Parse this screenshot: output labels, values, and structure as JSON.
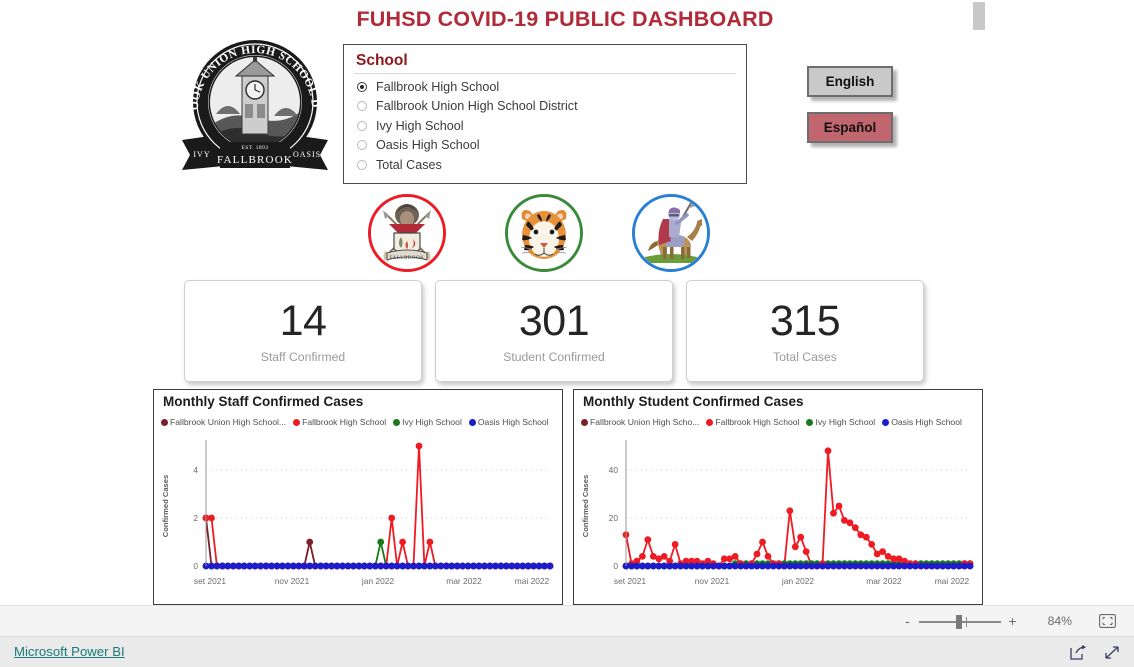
{
  "title": "FUHSD COVID-19 PUBLIC DASHBOARD",
  "seal": {
    "arc_text": "FALLBROOK UNION HIGH SCHOOL DISTRICT",
    "banner_left": "IVY",
    "banner_center": "FALLBROOK",
    "banner_right": "OASIS",
    "established": "EST. 1893"
  },
  "slicer": {
    "header": "School",
    "items": [
      {
        "label": "Fallbrook High School",
        "selected": true
      },
      {
        "label": "Fallbrook Union High School District",
        "selected": false
      },
      {
        "label": "Ivy High School",
        "selected": false
      },
      {
        "label": "Oasis High School",
        "selected": false
      },
      {
        "label": "Total Cases",
        "selected": false
      }
    ]
  },
  "language": {
    "english_label": "English",
    "espanol_label": "Español",
    "english_bg": "#c9c9c9",
    "espanol_bg": "#c1666e"
  },
  "logos": [
    {
      "name": "fallbrook-warriors-logo",
      "ring_color": "#ec1c24"
    },
    {
      "name": "ivy-tigers-logo",
      "ring_color": "#3a8a3a"
    },
    {
      "name": "oasis-knights-logo",
      "ring_color": "#2a7fd4"
    }
  ],
  "kpis": [
    {
      "value": "14",
      "label": "Staff Confirmed"
    },
    {
      "value": "301",
      "label": "Student Confirmed"
    },
    {
      "value": "315",
      "label": "Total Cases"
    }
  ],
  "status_bar": {
    "zoom_out": "-",
    "zoom_in": "+",
    "zoom_percent": "84%",
    "fit_to_screen_icon": "fit-to-screen-icon"
  },
  "footer": {
    "powerbi_label": "Microsoft Power BI",
    "share_icon": "share-icon",
    "fullscreen_icon": "fullscreen-icon"
  },
  "colors": {
    "title_red": "#b02a37",
    "slicer_header_red": "#8b1a1a",
    "series_district": "#7b1f2a",
    "series_fallbrook": "#ee1b22",
    "series_ivy": "#1a7a1a",
    "series_oasis": "#1c1ccc",
    "link_teal": "#1a7a7a"
  },
  "chart_data": [
    {
      "type": "line",
      "title": "Monthly Staff Confirmed Cases",
      "xlabel": "",
      "ylabel": "Confirmed Cases",
      "ylim": [
        0,
        5
      ],
      "yticks": [
        0,
        2,
        4
      ],
      "xticks": [
        "set 2021",
        "nov 2021",
        "jan 2022",
        "mar 2022",
        "mai 2022"
      ],
      "grid": true,
      "legend_position": "top",
      "legend": [
        "Fallbrook Union High School...",
        "Fallbrook High School",
        "Ivy High School",
        "Oasis High School"
      ],
      "x": [
        0,
        1,
        2,
        3,
        4,
        5,
        6,
        7,
        8,
        9,
        10,
        11,
        12,
        13,
        14,
        15,
        16,
        17,
        18,
        19,
        20,
        21,
        22,
        23,
        24,
        25,
        26,
        27,
        28,
        29,
        30,
        31,
        32,
        33,
        34,
        35,
        36,
        37,
        38,
        39,
        40,
        41,
        42,
        43,
        44,
        45,
        46,
        47,
        48,
        49,
        50,
        51,
        52,
        53,
        54,
        55,
        56,
        57,
        58,
        59,
        60,
        61,
        62,
        63
      ],
      "series": [
        {
          "name": "Fallbrook Union High School...",
          "color": "#7b1f2a",
          "values": [
            2,
            0,
            0,
            0,
            0,
            0,
            0,
            0,
            0,
            0,
            0,
            0,
            0,
            0,
            0,
            0,
            0,
            0,
            0,
            1,
            0,
            0,
            0,
            0,
            0,
            0,
            0,
            0,
            0,
            0,
            0,
            0,
            0,
            0,
            0,
            0,
            0,
            0,
            0,
            0,
            0,
            0,
            0,
            0,
            0,
            0,
            0,
            0,
            0,
            0,
            0,
            0,
            0,
            0,
            0,
            0,
            0,
            0,
            0,
            0,
            0,
            0,
            0,
            0
          ]
        },
        {
          "name": "Fallbrook High School",
          "color": "#ee1b22",
          "values": [
            2,
            2,
            0,
            0,
            0,
            0,
            0,
            0,
            0,
            0,
            0,
            0,
            0,
            0,
            0,
            0,
            0,
            0,
            0,
            0,
            0,
            0,
            0,
            0,
            0,
            0,
            0,
            0,
            0,
            0,
            0,
            0,
            0,
            0,
            2,
            0,
            1,
            0,
            0,
            5,
            0,
            1,
            0,
            0,
            0,
            0,
            0,
            0,
            0,
            0,
            0,
            0,
            0,
            0,
            0,
            0,
            0,
            0,
            0,
            0,
            0,
            0,
            0,
            0
          ]
        },
        {
          "name": "Ivy High School",
          "color": "#1a7a1a",
          "values": [
            0,
            0,
            0,
            0,
            0,
            0,
            0,
            0,
            0,
            0,
            0,
            0,
            0,
            0,
            0,
            0,
            0,
            0,
            0,
            0,
            0,
            0,
            0,
            0,
            0,
            0,
            0,
            0,
            0,
            0,
            0,
            0,
            1,
            0,
            0,
            0,
            0,
            0,
            0,
            0,
            0,
            0,
            0,
            0,
            0,
            0,
            0,
            0,
            0,
            0,
            0,
            0,
            0,
            0,
            0,
            0,
            0,
            0,
            0,
            0,
            0,
            0,
            0,
            0
          ]
        },
        {
          "name": "Oasis High School",
          "color": "#1c1ccc",
          "values": [
            0,
            0,
            0,
            0,
            0,
            0,
            0,
            0,
            0,
            0,
            0,
            0,
            0,
            0,
            0,
            0,
            0,
            0,
            0,
            0,
            0,
            0,
            0,
            0,
            0,
            0,
            0,
            0,
            0,
            0,
            0,
            0,
            0,
            0,
            0,
            0,
            0,
            0,
            0,
            0,
            0,
            0,
            0,
            0,
            0,
            0,
            0,
            0,
            0,
            0,
            0,
            0,
            0,
            0,
            0,
            0,
            0,
            0,
            0,
            0,
            0,
            0,
            0,
            0
          ]
        }
      ]
    },
    {
      "type": "line",
      "title": "Monthly Student Confirmed Cases",
      "xlabel": "",
      "ylabel": "Confirmed Cases",
      "ylim": [
        0,
        50
      ],
      "yticks": [
        0,
        20,
        40
      ],
      "xticks": [
        "set 2021",
        "nov 2021",
        "jan 2022",
        "mar 2022",
        "mai 2022"
      ],
      "grid": true,
      "legend_position": "top",
      "legend": [
        "Fallbrook Union High Scho...",
        "Fallbrook High School",
        "Ivy High School",
        "Oasis High School"
      ],
      "x": [
        0,
        1,
        2,
        3,
        4,
        5,
        6,
        7,
        8,
        9,
        10,
        11,
        12,
        13,
        14,
        15,
        16,
        17,
        18,
        19,
        20,
        21,
        22,
        23,
        24,
        25,
        26,
        27,
        28,
        29,
        30,
        31,
        32,
        33,
        34,
        35,
        36,
        37,
        38,
        39,
        40,
        41,
        42,
        43,
        44,
        45,
        46,
        47,
        48,
        49,
        50,
        51,
        52,
        53,
        54,
        55,
        56,
        57,
        58,
        59,
        60,
        61,
        62,
        63
      ],
      "series": [
        {
          "name": "Fallbrook Union High Scho...",
          "color": "#7b1f2a",
          "values": [
            0,
            0,
            0,
            0,
            0,
            0,
            0,
            0,
            0,
            0,
            0,
            0,
            0,
            0,
            0,
            0,
            0,
            0,
            0,
            0,
            0,
            0,
            0,
            0,
            0,
            0,
            0,
            0,
            0,
            0,
            0,
            0,
            0,
            0,
            0,
            0,
            0,
            0,
            0,
            0,
            0,
            0,
            0,
            0,
            0,
            0,
            0,
            0,
            0,
            0,
            0,
            0,
            0,
            0,
            0,
            0,
            0,
            0,
            0,
            0,
            0,
            0,
            0,
            0
          ]
        },
        {
          "name": "Fallbrook High School",
          "color": "#ee1b22",
          "values": [
            13,
            1,
            2,
            4,
            11,
            4,
            3,
            4,
            2,
            9,
            1,
            2,
            2,
            2,
            1,
            2,
            1,
            0,
            3,
            3,
            4,
            1,
            0,
            1,
            5,
            10,
            4,
            1,
            1,
            0,
            23,
            8,
            12,
            6,
            0,
            0,
            1,
            48,
            22,
            25,
            19,
            18,
            16,
            13,
            12,
            9,
            5,
            6,
            4,
            3,
            3,
            2,
            1,
            1,
            0,
            0,
            0,
            0,
            0,
            0,
            0,
            0,
            1,
            1
          ]
        },
        {
          "name": "Ivy High School",
          "color": "#1a7a1a",
          "values": [
            0,
            0,
            0,
            0,
            0,
            0,
            0,
            0,
            0,
            0,
            0,
            0,
            0,
            0,
            0,
            0,
            0,
            0,
            0,
            0,
            1,
            1,
            1,
            1,
            1,
            1,
            1,
            1,
            1,
            1,
            1,
            1,
            1,
            1,
            1,
            1,
            1,
            1,
            1,
            1,
            1,
            1,
            1,
            1,
            1,
            1,
            1,
            1,
            1,
            1,
            1,
            1,
            1,
            1,
            1,
            1,
            1,
            1,
            1,
            1,
            1,
            1,
            1,
            1
          ]
        },
        {
          "name": "Oasis High School",
          "color": "#1c1ccc",
          "values": [
            0,
            0,
            0,
            0,
            0,
            0,
            0,
            0,
            0,
            0,
            0,
            0,
            0,
            0,
            0,
            0,
            0,
            0,
            0,
            0,
            0,
            0,
            0,
            0,
            0,
            0,
            0,
            0,
            0,
            0,
            0,
            0,
            0,
            0,
            0,
            0,
            0,
            0,
            0,
            0,
            0,
            0,
            0,
            0,
            0,
            0,
            0,
            0,
            0,
            0,
            0,
            0,
            0,
            0,
            0,
            0,
            0,
            0,
            0,
            0,
            0,
            0,
            0,
            0
          ]
        }
      ]
    }
  ]
}
